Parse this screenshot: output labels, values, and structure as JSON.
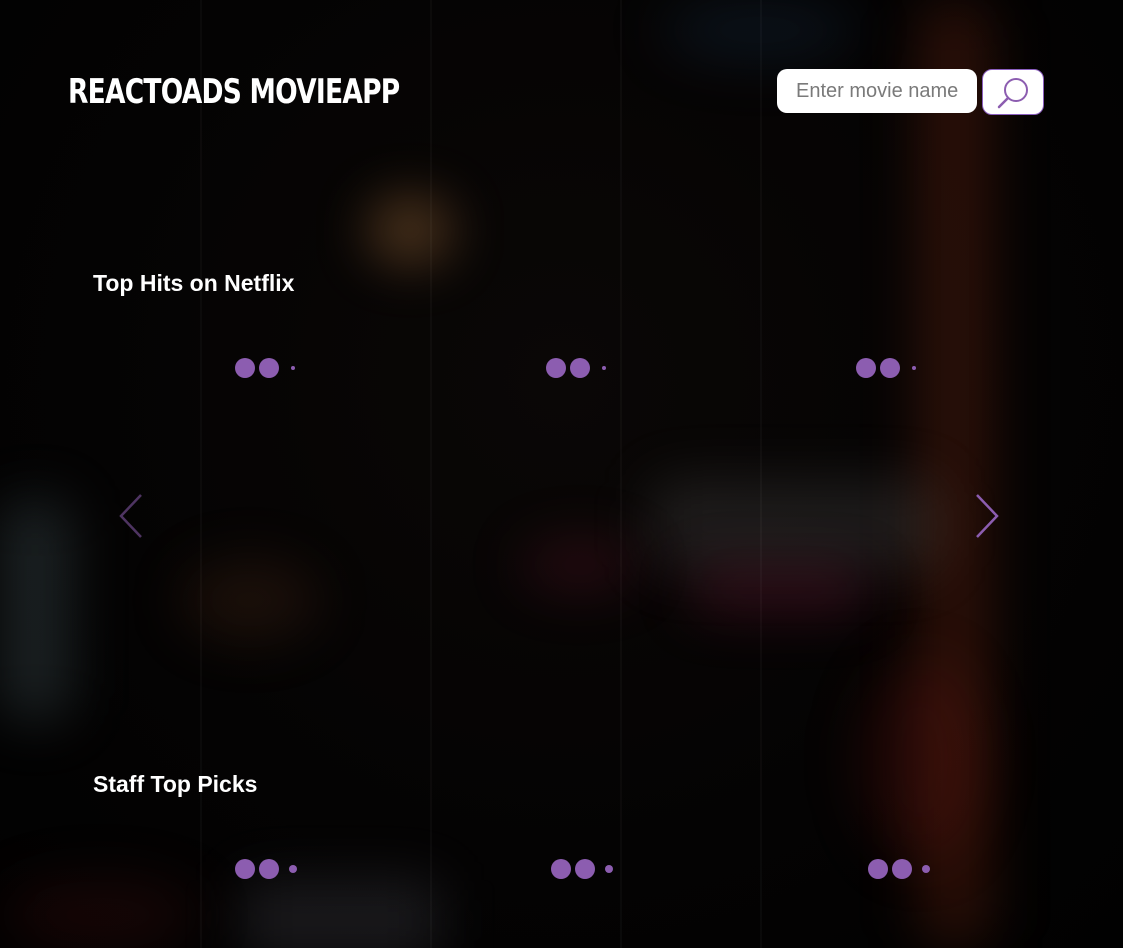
{
  "app": {
    "title": "REACTOADS MOVIEAPP"
  },
  "search": {
    "placeholder": "Enter movie name",
    "value": "",
    "button_icon": "search-icon"
  },
  "sections": [
    {
      "title": "Top Hits on Netflix",
      "loading_slots": 3,
      "prev_icon": "chevron-left-icon",
      "next_icon": "chevron-right-icon"
    },
    {
      "title": "Staff Top Picks",
      "loading_slots": 3
    }
  ],
  "colors": {
    "accent": "#8c5db0",
    "background": "#000000",
    "text": "#ffffff"
  }
}
